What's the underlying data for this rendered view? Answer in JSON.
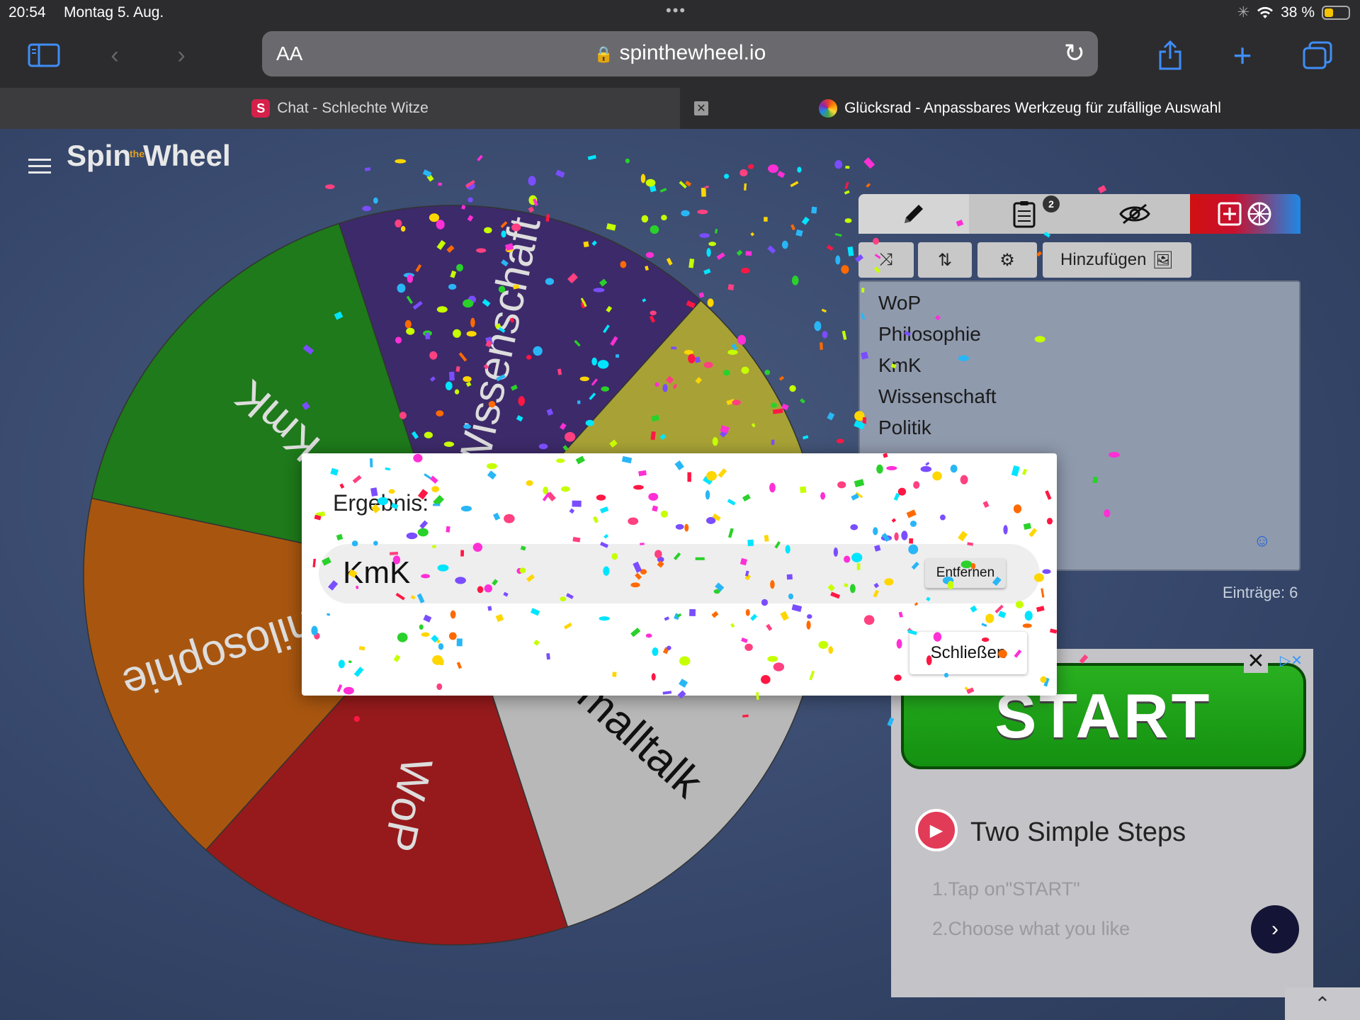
{
  "status": {
    "time": "20:54",
    "date": "Montag 5. Aug.",
    "battery": "38 %",
    "battery_level": 0.38
  },
  "browser": {
    "aa": "AA",
    "url": "spinthewheel.io"
  },
  "tabs": [
    {
      "label": "Chat - Schlechte Witze"
    },
    {
      "label": "Glücksrad - Anpassbares Werkzeug für zufällige Auswahl"
    }
  ],
  "logo": {
    "spin": "Spin",
    "the": "the",
    "wheel": "Wheel"
  },
  "wheel": {
    "segments": [
      {
        "label": "WoP",
        "color": "#961a1c"
      },
      {
        "label": "Philosophie",
        "color": "#a8560f"
      },
      {
        "label": "KmK",
        "color": "#1e7a1a"
      },
      {
        "label": "Wissenschaft",
        "color": "#3d2a6a"
      },
      {
        "label": "Politik",
        "color": "#a8a236"
      },
      {
        "label": "Smalltalk",
        "color": "#b8b8b8"
      }
    ]
  },
  "toolbar": {
    "badge": "2",
    "add_label": "Hinzufügen"
  },
  "entries": [
    "WoP",
    "Philosophie",
    "KmK",
    "Wissenschaft",
    "Politik"
  ],
  "entries_count": "Einträge: 6",
  "modal": {
    "title": "Ergebnis:",
    "result": "KmK",
    "remove_label": "Entfernen",
    "close_label": "Schließen"
  },
  "ad": {
    "start_label": "START",
    "title": "Two Simple Steps",
    "step1": "1.Tap on\"START\"",
    "step2": "2.Choose what you like"
  }
}
